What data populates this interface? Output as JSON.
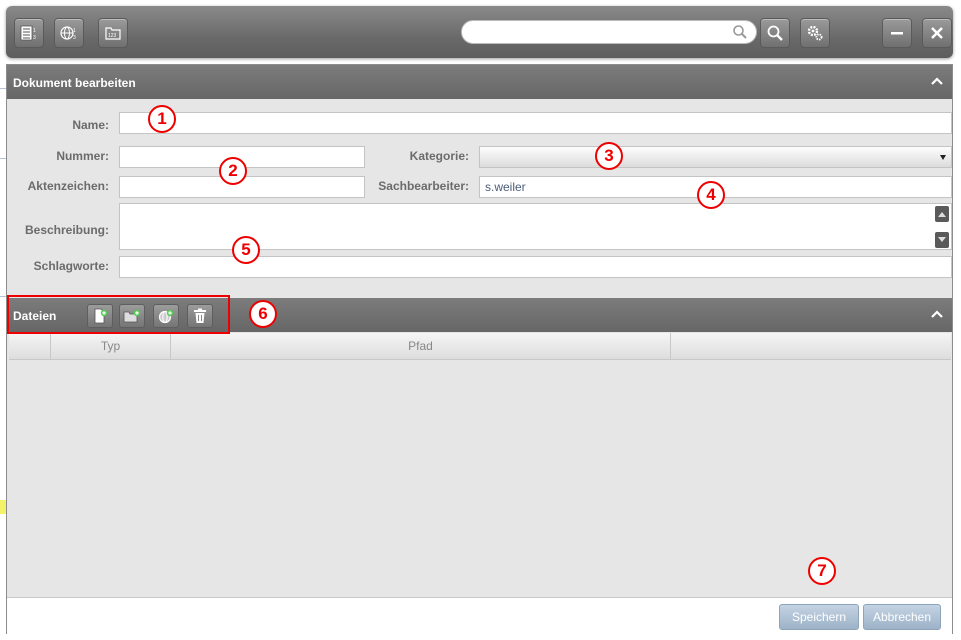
{
  "search": {
    "value": "",
    "placeholder": ""
  },
  "dialog": {
    "title": "Dokument bearbeiten",
    "fields": {
      "name_label": "Name:",
      "nummer_label": "Nummer:",
      "kategorie_label": "Kategorie:",
      "aktenzeichen_label": "Aktenzeichen:",
      "sachbearbeiter_label": "Sachbearbeiter:",
      "sachbearbeiter_value": "s.weiler",
      "beschreibung_label": "Beschreibung:",
      "schlagworte_label": "Schlagworte:"
    },
    "files": {
      "title": "Dateien",
      "columns": [
        "",
        "Typ",
        "Pfad",
        ""
      ]
    },
    "buttons": {
      "save": "Speichern",
      "cancel": "Abbrechen"
    }
  },
  "callouts": [
    "1",
    "2",
    "3",
    "4",
    "5",
    "6",
    "7"
  ],
  "colors": {
    "callout": "#e00000",
    "header": "#6e6e6e",
    "button": "#a8bcd0"
  }
}
